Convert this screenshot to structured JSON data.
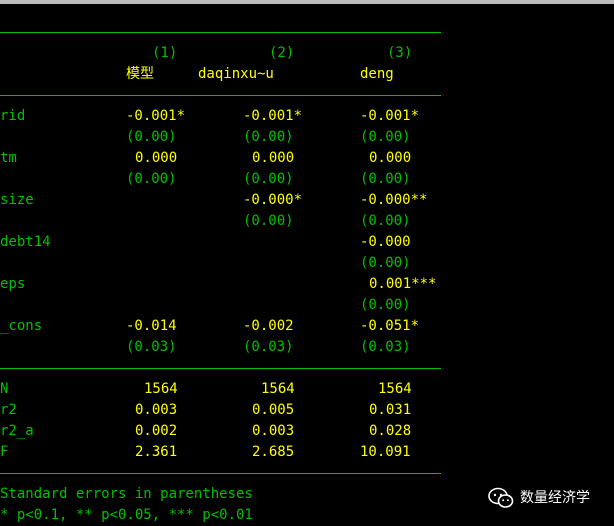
{
  "header": {
    "col_numbers": [
      "(1)",
      "(2)",
      "(3)"
    ],
    "col_names": [
      "模型",
      "daqinxu~u",
      "deng"
    ]
  },
  "coef_rows": [
    {
      "label": "rid",
      "values": [
        "-0.001*",
        "-0.001*",
        "-0.001*"
      ],
      "se": [
        "(0.00)",
        "(0.00)",
        "(0.00)"
      ]
    },
    {
      "label": "tm",
      "values": [
        "0.000",
        "0.000",
        "0.000"
      ],
      "se": [
        "(0.00)",
        "(0.00)",
        "(0.00)"
      ]
    },
    {
      "label": "size",
      "values": [
        "",
        "-0.000*",
        "-0.000**"
      ],
      "se": [
        "",
        "(0.00)",
        "(0.00)"
      ]
    },
    {
      "label": "debt14",
      "values": [
        "",
        "",
        "-0.000"
      ],
      "se": [
        "",
        "",
        "(0.00)"
      ]
    },
    {
      "label": "eps",
      "values": [
        "",
        "",
        "0.001***"
      ],
      "se": [
        "",
        "",
        "(0.00)"
      ]
    },
    {
      "label": "_cons",
      "values": [
        "-0.014",
        "-0.002",
        "-0.051*"
      ],
      "se": [
        "(0.03)",
        "(0.03)",
        "(0.03)"
      ]
    }
  ],
  "stat_rows": [
    {
      "label": "N",
      "values": [
        "1564",
        "1564",
        "1564"
      ]
    },
    {
      "label": "r2",
      "values": [
        "0.003",
        "0.005",
        "0.031"
      ]
    },
    {
      "label": "r2_a",
      "values": [
        "0.002",
        "0.003",
        "0.028"
      ]
    },
    {
      "label": "F",
      "values": [
        "2.361",
        "2.685",
        "10.091"
      ]
    }
  ],
  "footnotes": [
    "Standard errors in parentheses",
    "* p<0.1, ** p<0.05, *** p<0.01"
  ],
  "watermark": {
    "text": "数量经济学",
    "icon": "wechat-icon"
  },
  "colors": {
    "background": "#000000",
    "label": "#00c000",
    "value": "#ffff00",
    "rule": "#00c000"
  }
}
